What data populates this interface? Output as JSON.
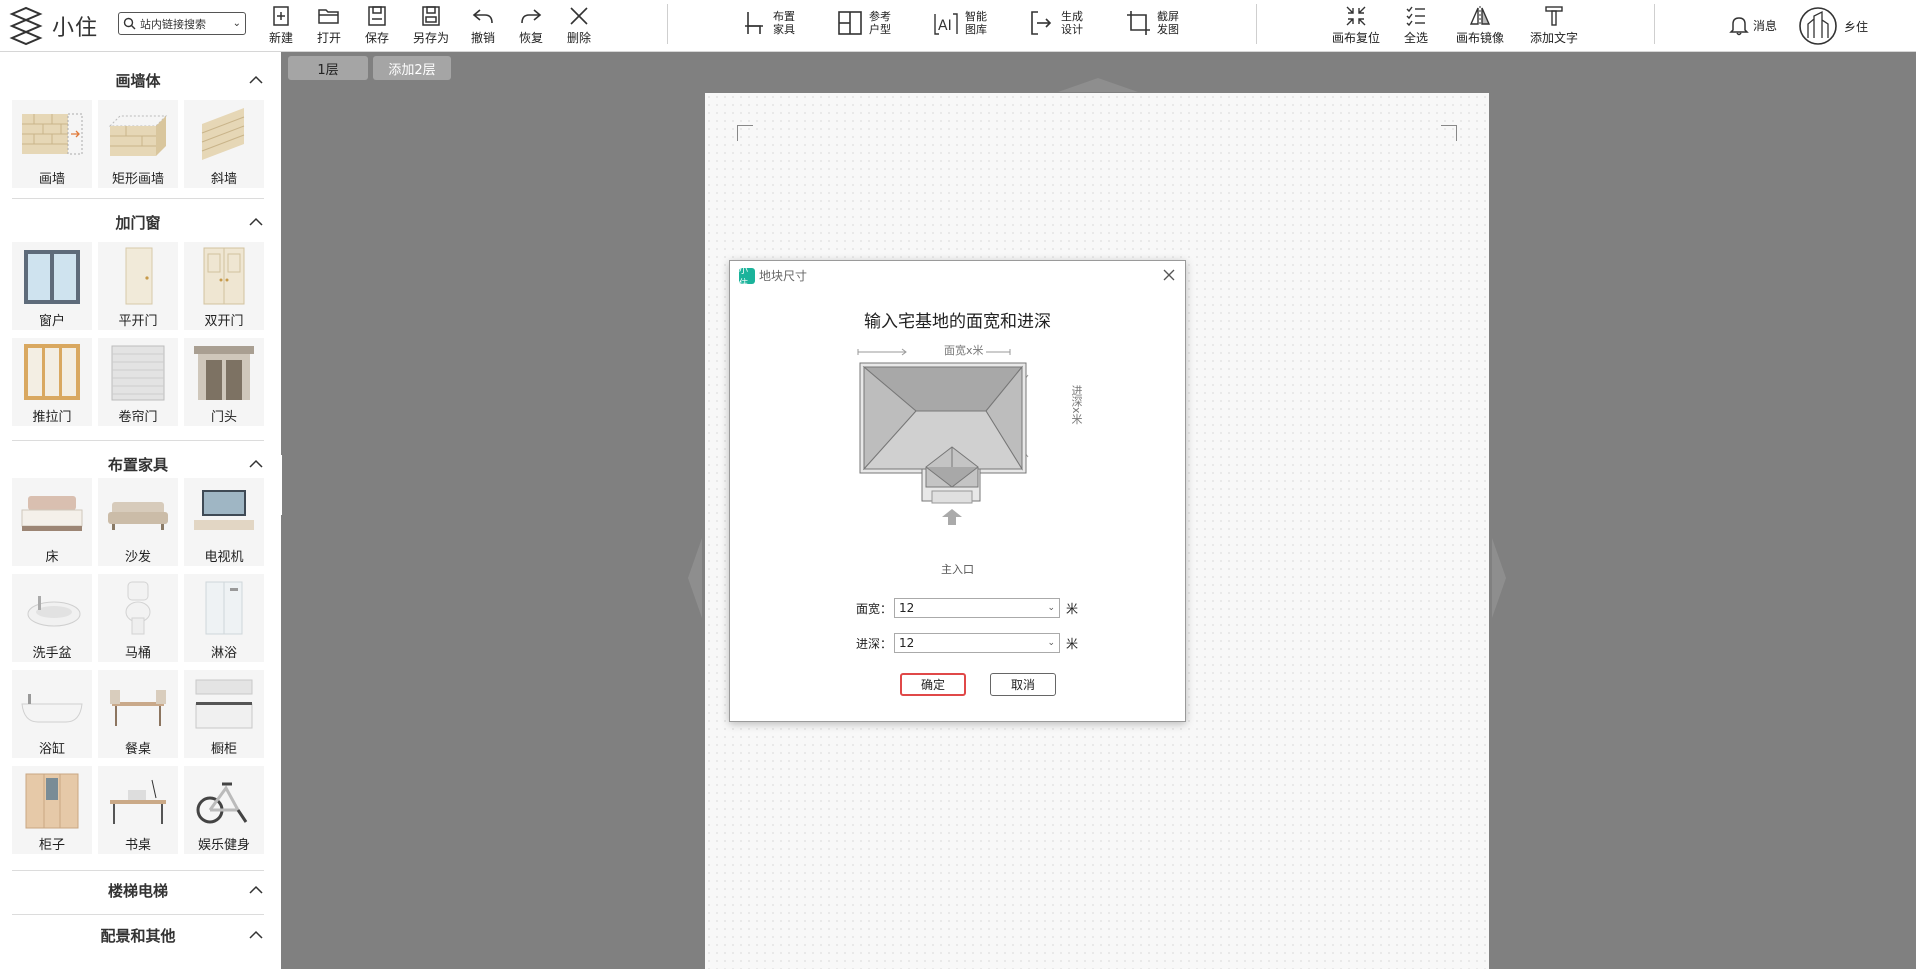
{
  "app": {
    "logo_text": "小住"
  },
  "search": {
    "label": "站内链接搜索",
    "caret": "⌄"
  },
  "toolbar": {
    "new": "新建",
    "open": "打开",
    "save": "保存",
    "save_as": "另存为",
    "undo": "撤销",
    "redo": "恢复",
    "delete": "删除",
    "furniture_l1": "布置",
    "furniture_l2": "家具",
    "reference_l1": "参考",
    "reference_l2": "户型",
    "smart_l1": "智能",
    "smart_l2": "图库",
    "design_l1": "生成",
    "design_l2": "设计",
    "screenshot_l1": "截屏",
    "screenshot_l2": "发图",
    "reset_canvas": "画布复位",
    "select_all": "全选",
    "mirror": "画布镜像",
    "add_text": "添加文字",
    "messages": "消息",
    "user_name": "乡住"
  },
  "sidebar": {
    "walls": {
      "title": "画墙体",
      "items": [
        "画墙",
        "矩形画墙",
        "斜墙"
      ]
    },
    "doors": {
      "title": "加门窗",
      "items": [
        "窗户",
        "平开门",
        "双开门",
        "推拉门",
        "卷帘门",
        "门头"
      ]
    },
    "furniture": {
      "title": "布置家具",
      "items": [
        "床",
        "沙发",
        "电视机",
        "洗手盆",
        "马桶",
        "淋浴",
        "浴缸",
        "餐桌",
        "橱柜",
        "柜子",
        "书桌",
        "娱乐健身"
      ]
    },
    "stairs": {
      "title": "楼梯电梯"
    },
    "others": {
      "title": "配景和其他"
    }
  },
  "floors": {
    "floor1": "1层",
    "floor2": "添加2层"
  },
  "dialog": {
    "title": "地块尺寸",
    "logo": "小住",
    "heading": "输入宅基地的面宽和进深",
    "width_hint": "面宽x米",
    "depth_hint": "进深x米",
    "entrance": "主入口",
    "width_label": "面宽：",
    "width_value": "12",
    "depth_label": "进深：",
    "depth_value": "12",
    "unit": "米",
    "ok": "确定",
    "cancel": "取消"
  }
}
